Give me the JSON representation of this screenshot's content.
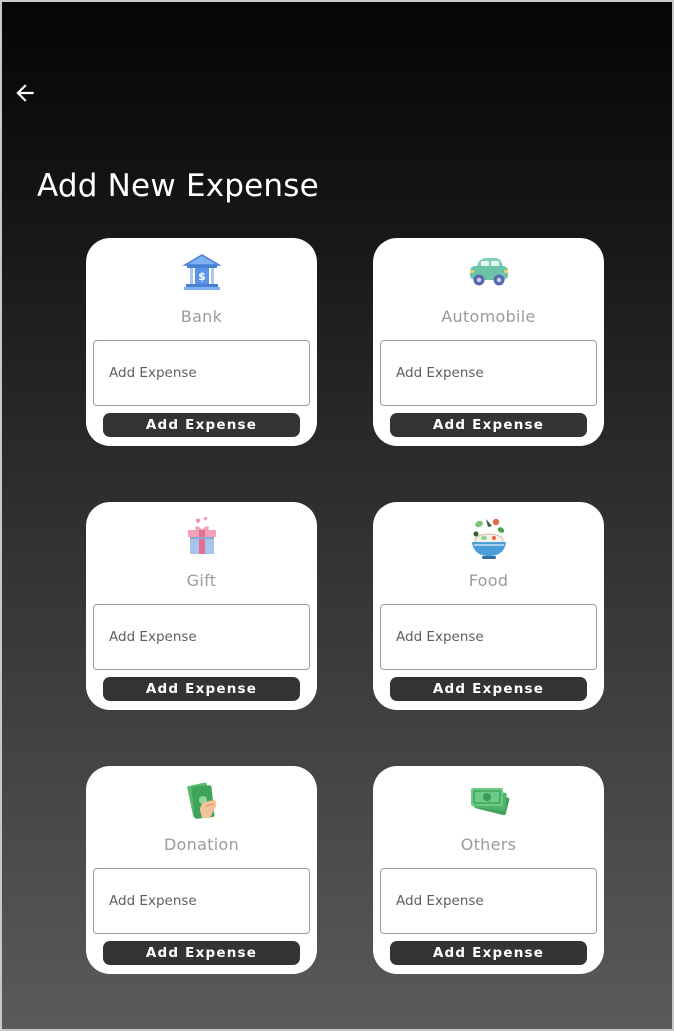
{
  "header": {
    "back_icon": "arrow-left-icon",
    "title": "Add New Expense"
  },
  "categories": [
    {
      "name": "Bank",
      "icon": "bank-icon",
      "input_placeholder": "Add Expense",
      "input_value": "",
      "button_label": "Add Expense"
    },
    {
      "name": "Automobile",
      "icon": "car-icon",
      "input_placeholder": "Add Expense",
      "input_value": "",
      "button_label": "Add Expense"
    },
    {
      "name": "Gift",
      "icon": "gift-icon",
      "input_placeholder": "Add Expense",
      "input_value": "",
      "button_label": "Add Expense"
    },
    {
      "name": "Food",
      "icon": "food-bowl-icon",
      "input_placeholder": "Add Expense",
      "input_value": "",
      "button_label": "Add Expense"
    },
    {
      "name": "Donation",
      "icon": "money-hand-icon",
      "input_placeholder": "Add Expense",
      "input_value": "",
      "button_label": "Add Expense"
    },
    {
      "name": "Others",
      "icon": "cash-stack-icon",
      "input_placeholder": "Add Expense",
      "input_value": "",
      "button_label": "Add Expense"
    }
  ],
  "colors": {
    "background_top": "#050505",
    "background_bottom": "#5a5a5a",
    "card": "#ffffff",
    "button": "#343434",
    "category_label": "#9b9b9b"
  }
}
